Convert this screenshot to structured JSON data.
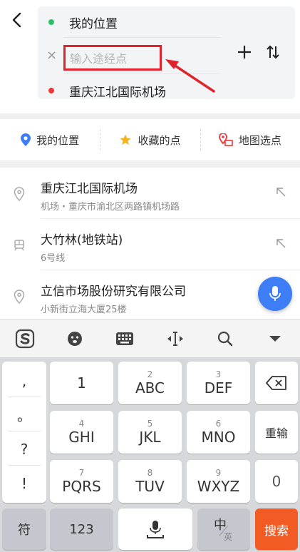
{
  "route": {
    "origin": "我的位置",
    "via_placeholder": "输入途经点",
    "destination": "重庆江北国际机场"
  },
  "quick_options": [
    {
      "label": "我的位置",
      "icon": "location-pin-icon"
    },
    {
      "label": "收藏的点",
      "icon": "star-icon"
    },
    {
      "label": "地图选点",
      "icon": "map-pick-icon"
    }
  ],
  "results": [
    {
      "title": "重庆江北国际机场",
      "subtitle": "机场・重庆市渝北区两路镇机场路",
      "icon": "location-pin-icon"
    },
    {
      "title": "大竹林(地铁站)",
      "subtitle": "6号线",
      "icon": "subway-icon"
    },
    {
      "title": "立信市场股份研究有限公司",
      "subtitle": "小新街立海大厦25楼",
      "icon": "location-pin-icon"
    }
  ],
  "keyboard": {
    "punct": [
      ",",
      "。",
      "?",
      "!"
    ],
    "row1": [
      {
        "num": "",
        "letters": "1"
      },
      {
        "num": "2",
        "letters": "ABC"
      },
      {
        "num": "3",
        "letters": "DEF"
      }
    ],
    "row2": [
      {
        "num": "4",
        "letters": "GHI"
      },
      {
        "num": "5",
        "letters": "JKL"
      },
      {
        "num": "6",
        "letters": "MNO"
      }
    ],
    "row3": [
      {
        "num": "7",
        "letters": "PQRS"
      },
      {
        "num": "8",
        "letters": "TUV"
      },
      {
        "num": "9",
        "letters": "WXYZ"
      }
    ],
    "reinput": "重输",
    "zero": "0",
    "symbol": "符",
    "num123": "123",
    "lang_main": "中",
    "lang_sub": "英",
    "search": "搜索"
  },
  "colors": {
    "accent_blue": "#3d7df5",
    "annotation_red": "#e0232a",
    "search_orange": "#f35b24",
    "origin_green": "#2bbf6c"
  }
}
